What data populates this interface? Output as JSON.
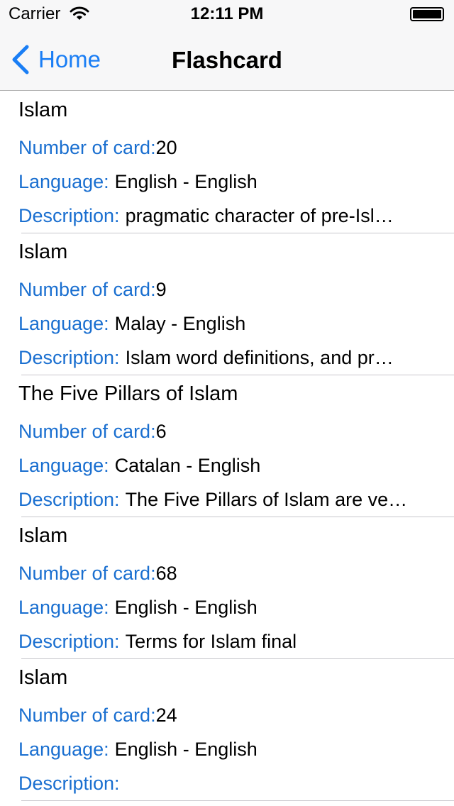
{
  "status_bar": {
    "carrier": "Carrier",
    "time": "12:11 PM"
  },
  "nav": {
    "back_label": "Home",
    "title": "Flashcard"
  },
  "labels": {
    "number_of_card": "Number of card:",
    "language": "Language:",
    "description": "Description:"
  },
  "items": [
    {
      "title": "Islam",
      "number_of_card": "20",
      "language": "English - English",
      "description": "pragmatic character of pre-Isl…"
    },
    {
      "title": "Islam",
      "number_of_card": "9",
      "language": "Malay - English",
      "description": "Islam word definitions, and pr…"
    },
    {
      "title": "The Five Pillars of Islam",
      "number_of_card": "6",
      "language": "Catalan - English",
      "description": "The Five Pillars of Islam are ve…"
    },
    {
      "title": "Islam",
      "number_of_card": "68",
      "language": "English - English",
      "description": "Terms for Islam final"
    },
    {
      "title": "Islam",
      "number_of_card": "24",
      "language": "English - English",
      "description": ""
    }
  ],
  "colors": {
    "accent": "#1a7ef5",
    "label": "#1a6fd0",
    "separator": "#c8c7cc",
    "bar_background": "#f7f7f8"
  },
  "icons": {
    "wifi": "wifi-icon",
    "battery": "battery-icon",
    "back": "chevron-left-icon"
  }
}
